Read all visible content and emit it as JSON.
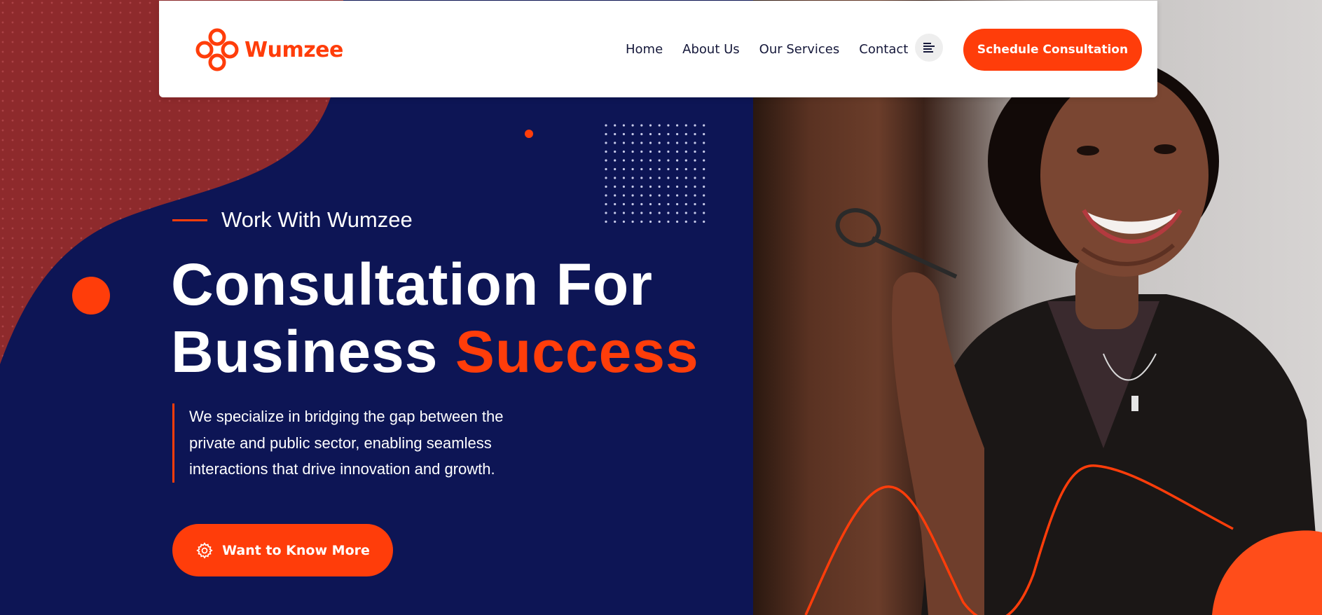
{
  "brand": {
    "name": "Wumzee",
    "color": "#ff3d0a",
    "logo_icon": "knot-logo-icon"
  },
  "nav": {
    "items": [
      {
        "label": "Home"
      },
      {
        "label": "About Us"
      },
      {
        "label": "Our Services"
      },
      {
        "label": "Contact"
      }
    ],
    "menu_icon": "menu-align-left-icon",
    "cta_label": "Schedule Consultation"
  },
  "hero": {
    "eyebrow": "Work With Wumzee",
    "headline_line1": "Consultation For",
    "headline_line2": "Business ",
    "headline_accent": "Success",
    "description_lines": [
      "We specialize in bridging the gap between the",
      "private and public sector, enabling seamless",
      "interactions that drive innovation and growth."
    ],
    "button_label": "Want to Know More",
    "button_icon": "gear-icon"
  },
  "colors": {
    "navy": "#0d1555",
    "accent": "#ff3d0a",
    "maroon": "#8e2a2c",
    "white": "#ffffff"
  }
}
